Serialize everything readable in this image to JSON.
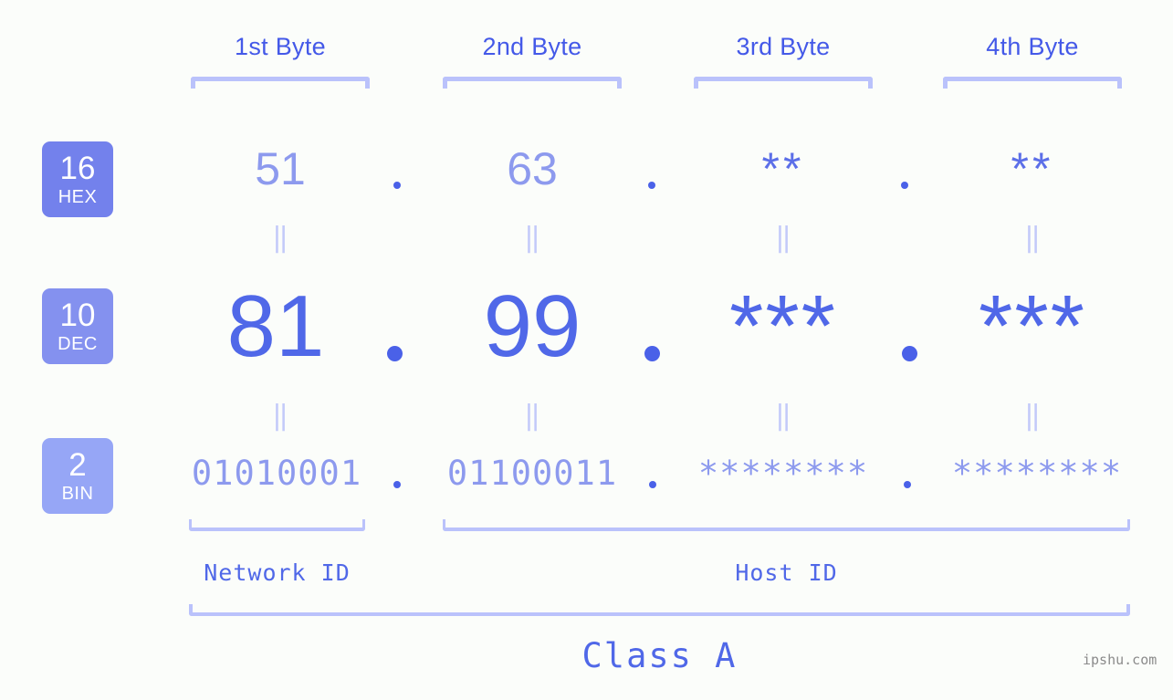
{
  "background_color": "#fbfdfa",
  "accent_color": "#5068e8",
  "bracket_color": "#bac2fb",
  "headers": [
    {
      "label": "1st Byte"
    },
    {
      "label": "2nd Byte"
    },
    {
      "label": "3rd Byte"
    },
    {
      "label": "4th Byte"
    }
  ],
  "radix_badges": [
    {
      "number": "16",
      "name": "HEX",
      "color": "#7381ec"
    },
    {
      "number": "10",
      "name": "DEC",
      "color": "#8491ef"
    },
    {
      "number": "2",
      "name": "BIN",
      "color": "#96a6f6"
    }
  ],
  "rows": {
    "hex": {
      "values": [
        "51",
        "63",
        "**",
        "**"
      ]
    },
    "dec": {
      "values": [
        "81",
        "99",
        "***",
        "***"
      ]
    },
    "bin": {
      "values": [
        "01010001",
        "01100011",
        "********",
        "********"
      ]
    }
  },
  "equals_symbol": "‖",
  "separator": ".",
  "segments": {
    "network_id": "Network ID",
    "host_id": "Host ID"
  },
  "class_label": "Class A",
  "watermark": "ipshu.com"
}
